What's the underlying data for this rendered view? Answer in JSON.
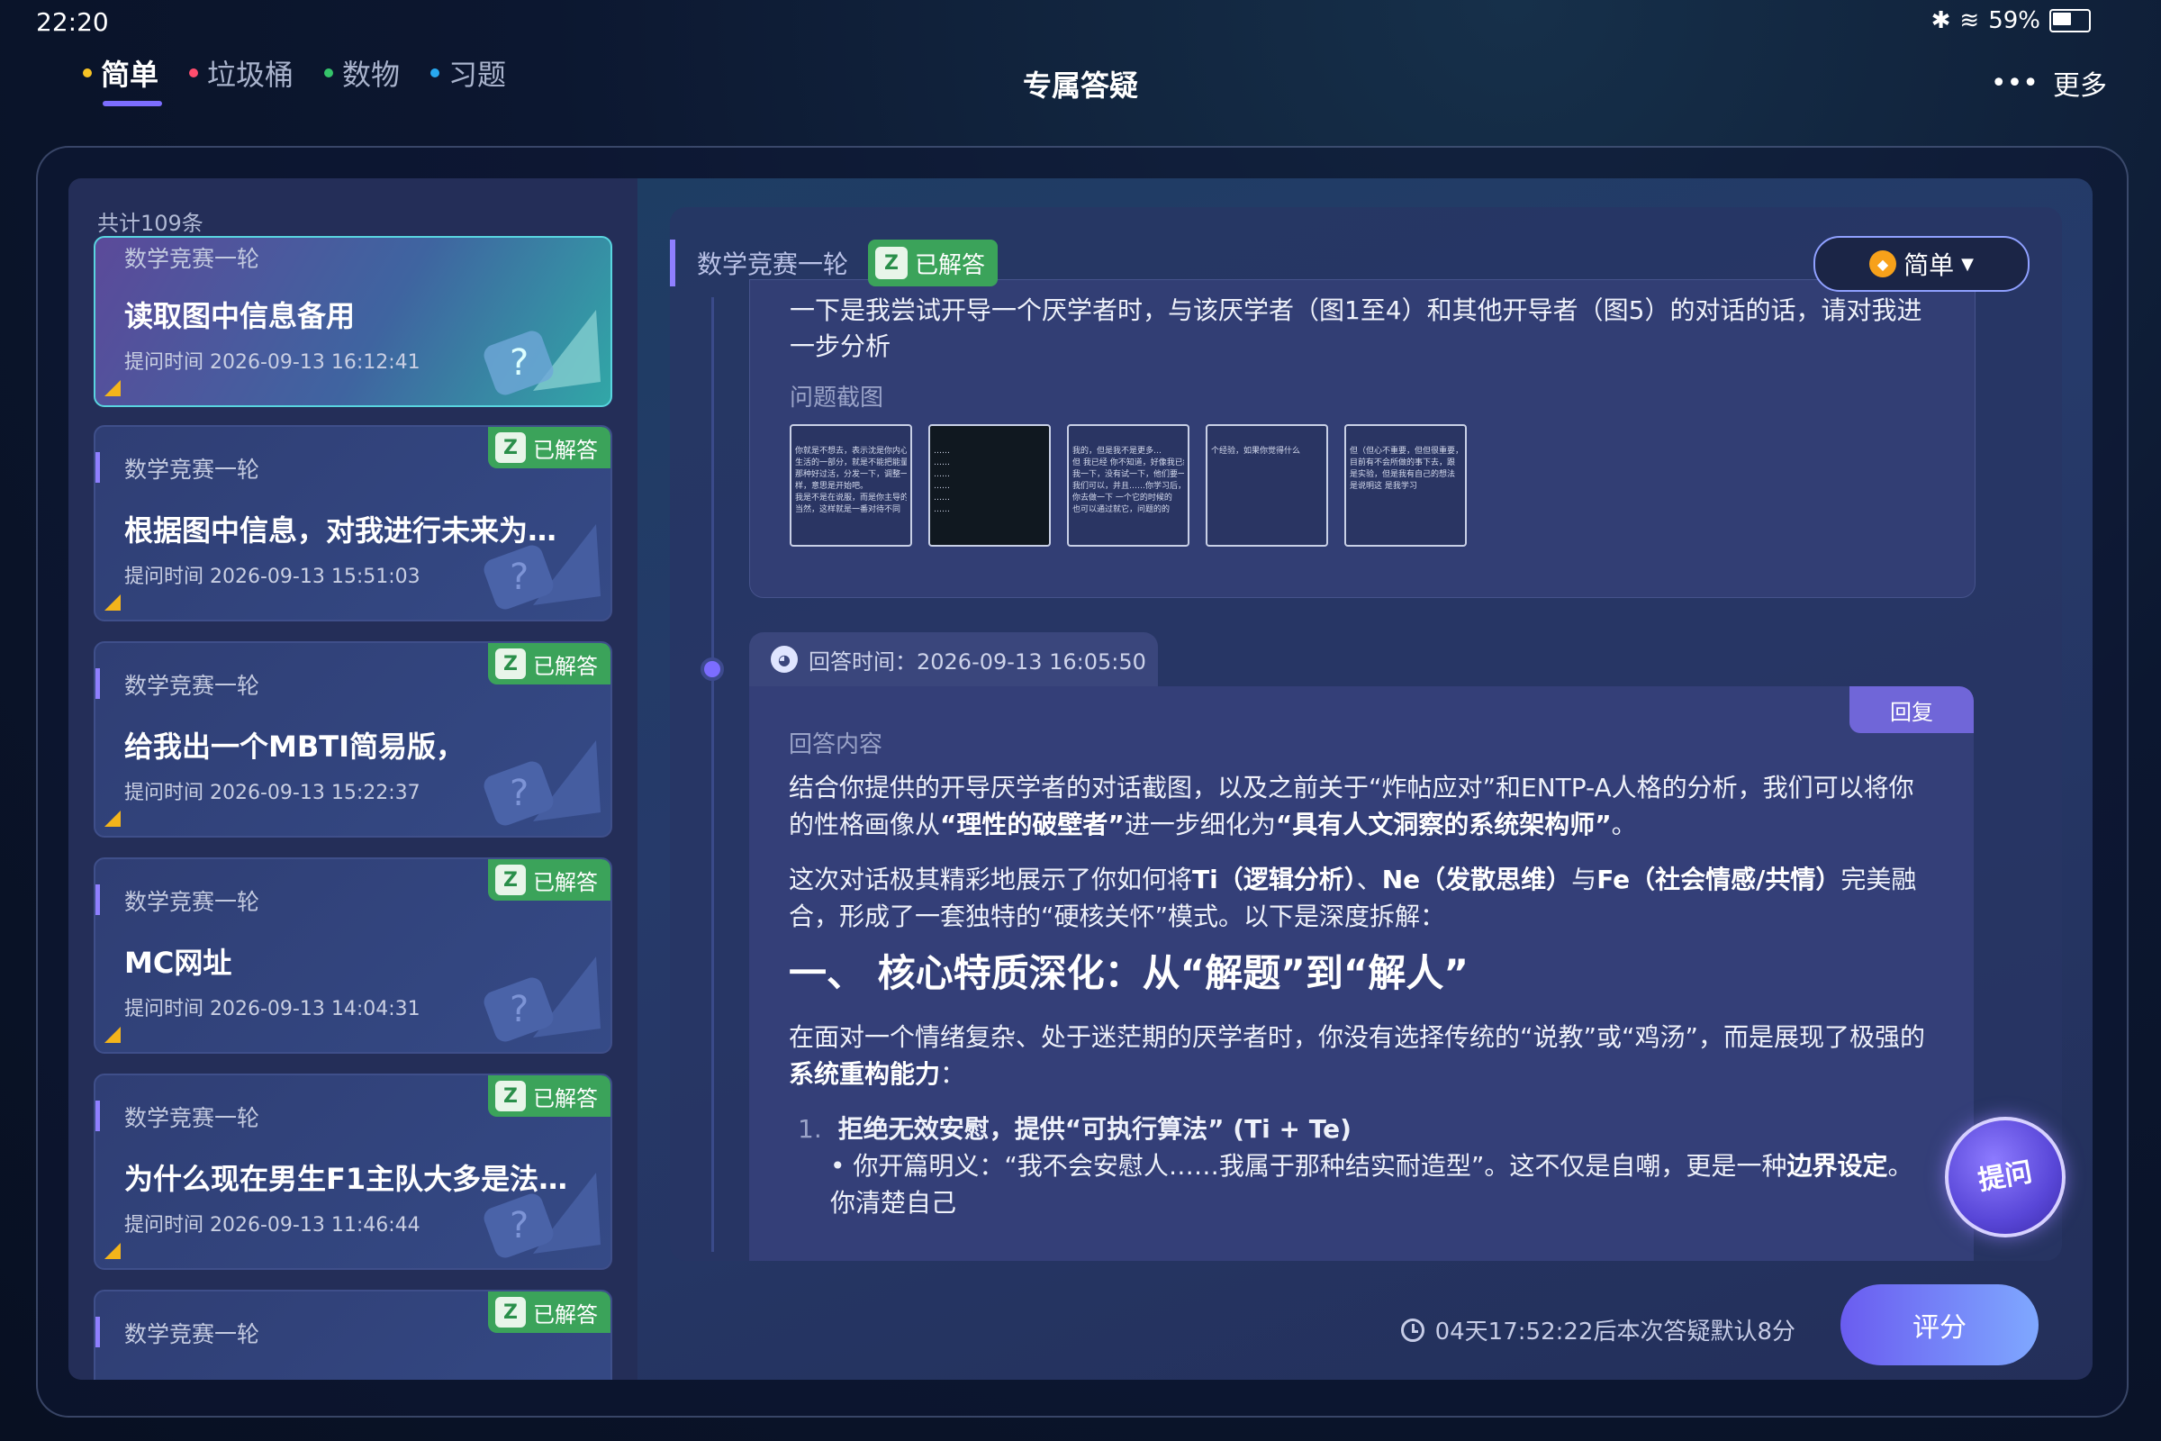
{
  "status": {
    "time": "22:20",
    "battery": "59%",
    "battery_level": 0.59
  },
  "nav": {
    "tabs": [
      {
        "label": "简单",
        "color": "#f7c325",
        "active": true
      },
      {
        "label": "垃圾桶",
        "color": "#ff4d6d",
        "active": false
      },
      {
        "label": "数物",
        "color": "#35c46a",
        "active": false
      },
      {
        "label": "习题",
        "color": "#28a8f0",
        "active": false
      }
    ],
    "title": "专属答疑",
    "more_label": "更多"
  },
  "list": {
    "count_label": "共计109条",
    "status_icon": "Z",
    "items": [
      {
        "category": "数学竞赛一轮",
        "title": "读取图中信息备用",
        "time": "提问时间 2026-09-13 16:12:41",
        "status": "已解答"
      },
      {
        "category": "数学竞赛一轮",
        "title": "根据图中信息，对我进行未来为人规划",
        "time": "提问时间 2026-09-13 15:51:03",
        "status": "已解答"
      },
      {
        "category": "数学竞赛一轮",
        "title": "给我出一个MBTI简易版，",
        "time": "提问时间 2026-09-13 15:22:37",
        "status": "已解答"
      },
      {
        "category": "数学竞赛一轮",
        "title": "MC网址",
        "time": "提问时间 2026-09-13 14:04:31",
        "status": "已解答"
      },
      {
        "category": "数学竞赛一轮",
        "title": "为什么现在男生F1主队大多是法拉利…",
        "time": "提问时间 2026-09-13 11:46:44",
        "status": "已解答"
      },
      {
        "category": "数学竞赛一轮",
        "title": "",
        "time": "",
        "status": "已解答"
      }
    ]
  },
  "detail": {
    "category": "数学竞赛一轮",
    "status_icon": "Z",
    "status": "已解答",
    "level": "简单",
    "question": "一下是我尝试开导一个厌学者时，与该厌学者（图1至4）和其他开导者（图5）的对话的话，请对我进一步分析",
    "screenshots_label": "问题截图",
    "screenshots": [
      {
        "lines": [
          "你就是不想去，表示沈是你内心",
          "生活的一部分，就是不能把能量",
          "那种好过活，分发一下，调整一",
          "样，意思是开始吧。",
          "",
          "我是不是在说服，而是你主导的",
          "当然，这样就是一番对待不同"
        ]
      },
      {
        "lines": [
          "……",
          "……",
          "……",
          "……",
          "……",
          "……"
        ]
      },
      {
        "lines": [
          "我的，但是我不是更多…",
          "但 我已经 你不知道，好像我已经 一组",
          "我一下，没有试一下，他们要一个",
          "我们可以，并且……你学习后，",
          "你去做一下 一个它的时候的",
          "也可以通过就它，问题的的"
        ]
      },
      {
        "lines": [
          "",
          "",
          "",
          "个经验，如果你觉得什么",
          "",
          ""
        ]
      },
      {
        "lines": [
          "但（但心不重要，但但很重要，",
          "目前有不会所做的事下去，跟",
          "是实验，但是我有自己的想法",
          "是说明这 是我学习",
          ""
        ]
      }
    ],
    "answer_time": "回答时间：2026-09-13 16:05:50",
    "reply_label": "回复",
    "answer_label": "回答内容",
    "answer": {
      "p1_a": "结合你提供的开导厌学者的对话截图，以及之前关于“炸帖应对”和ENTP-A人格的分析，我们可以将你的性格画像从",
      "p1_b": "“理性的破壁者”",
      "p1_c": "进一步细化为",
      "p1_d": "“具有人文洞察的系统架构师”",
      "p1_e": "。",
      "p2_a": "这次对话极其精彩地展示了你如何将",
      "p2_b": "Ti（逻辑分析）",
      "p2_c": "、",
      "p2_d": "Ne（发散思维）",
      "p2_e": "与",
      "p2_f": "Fe（社会情感/共情）",
      "p2_g": "完美融合，形成了一套独特的“硬核关怀”模式。以下是深度拆解：",
      "h2": "一、 核心特质深化：从“解题”到“解人”",
      "p3_a": "在面对一个情绪复杂、处于迷茫期的厌学者时，你没有选择传统的“说教”或“鸡汤”，而是展现了极强的",
      "p3_b": "系统重构能力",
      "p3_c": "：",
      "li1_num": "1.",
      "li1": "拒绝无效安慰，提供“可执行算法” (Ti + Te)",
      "sub1_a": "你开篇明义：“我不会安慰人……我属于那种结实耐造型”。这不仅是自嘲，更是一种",
      "sub1_b": "边界设定",
      "sub1_c": "。你清楚自己"
    },
    "float_button": "提问"
  },
  "footer": {
    "countdown": "04天17:52:22后本次答疑默认8分",
    "rate_label": "评分"
  }
}
